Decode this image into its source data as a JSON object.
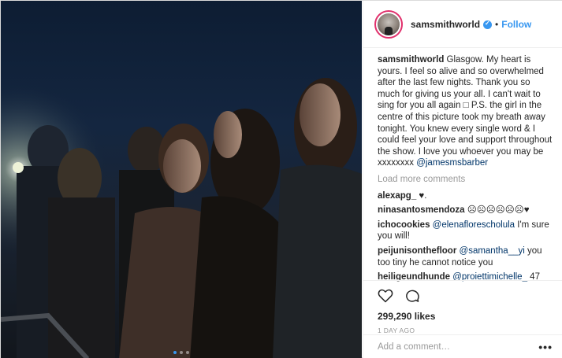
{
  "post": {
    "username": "samsmithworld",
    "follow_label": "Follow",
    "separator": "•",
    "caption_text": " Glasgow. My heart is yours. I feel so alive and so overwhelmed after the last few nights. Thank you so much for giving us your all. I can't wait to sing for you all again □ P.S. the girl in the centre of this picture took my breath away tonight. You knew every single word & I could feel your love and support throughout the show. I love you whoever you may be xxxxxxxx ",
    "caption_mention": "@jamesmsbarber",
    "load_more_label": "Load more comments"
  },
  "comments": [
    {
      "user": "alexapg_",
      "text": " ♥.",
      "mention": ""
    },
    {
      "user": "ninasantosmendoza",
      "text": " ☹☹☹☹☹☹♥",
      "mention": ""
    },
    {
      "user": "ichocookies",
      "text": " I'm sure you will!",
      "mention": "@elenaflorescholula"
    },
    {
      "user": "peijunisonthefloor",
      "text": " you too tiny he cannot notice you",
      "mention": "@samantha__yi"
    },
    {
      "user": "heiligeundhunde",
      "text": " 47",
      "mention": "@proiettimichelle_"
    }
  ],
  "actions": {
    "likes": "299,290 likes",
    "time": "1 DAY AGO"
  },
  "comment_box": {
    "placeholder": "Add a comment…",
    "more_label": "•••"
  },
  "colors": {
    "accent": "#3897f0",
    "mention": "#003569",
    "muted": "#999999"
  },
  "icons": [
    "heart-icon",
    "comment-icon",
    "verified-badge-icon",
    "more-options-icon"
  ],
  "carousel": {
    "count": 3,
    "active": 1
  }
}
